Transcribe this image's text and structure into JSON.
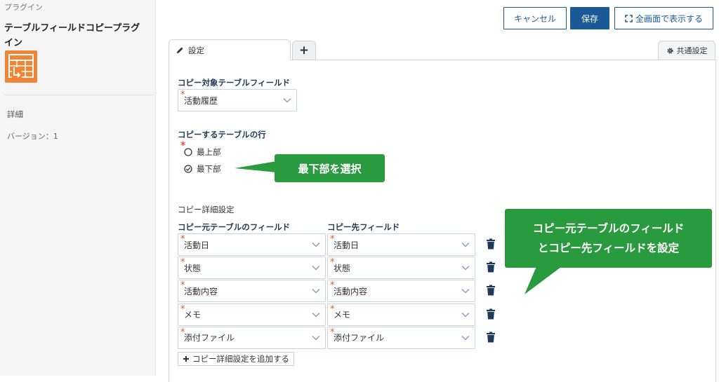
{
  "sidebar": {
    "category": "プラグイン",
    "title": "テーブルフィールドコピープラグイン",
    "detail_label": "詳細",
    "version_label": "バージョン：1"
  },
  "toolbar": {
    "cancel_label": "キャンセル",
    "save_label": "保存",
    "fullscreen_label": "全画面で表示する"
  },
  "tabs": {
    "settings_label": "設定",
    "add_label": "+",
    "common_label": "共通設定"
  },
  "form": {
    "copy_target_label": "コピー対象テーブルフィールド",
    "copy_target_value": "活動履歴",
    "row_label": "コピーするテーブルの行",
    "row_options": [
      "最上部",
      "最下部"
    ],
    "row_selected": "最下部",
    "detail_section_label": "コピー詳細設定",
    "source_col_label": "コピー元テーブルのフィールド",
    "dest_col_label": "コピー先フィールド",
    "rows": [
      {
        "source": "活動日",
        "dest": "活動日"
      },
      {
        "source": "状態",
        "dest": "状態"
      },
      {
        "source": "活動内容",
        "dest": "活動内容"
      },
      {
        "source": "メモ",
        "dest": "メモ"
      },
      {
        "source": "添付ファイル",
        "dest": "添付ファイル"
      }
    ],
    "add_button_label": "コピー詳細設定を追加する"
  },
  "callouts": {
    "select_bottom": "最下部を選択",
    "fields_line1": "コピー元テーブルのフィールド",
    "fields_line2": "とコピー先フィールドを設定"
  },
  "colors": {
    "primary": "#1a5b96",
    "callout_green": "#2a9a3e",
    "required": "#e8533a",
    "icon_orange": "#f08536"
  }
}
